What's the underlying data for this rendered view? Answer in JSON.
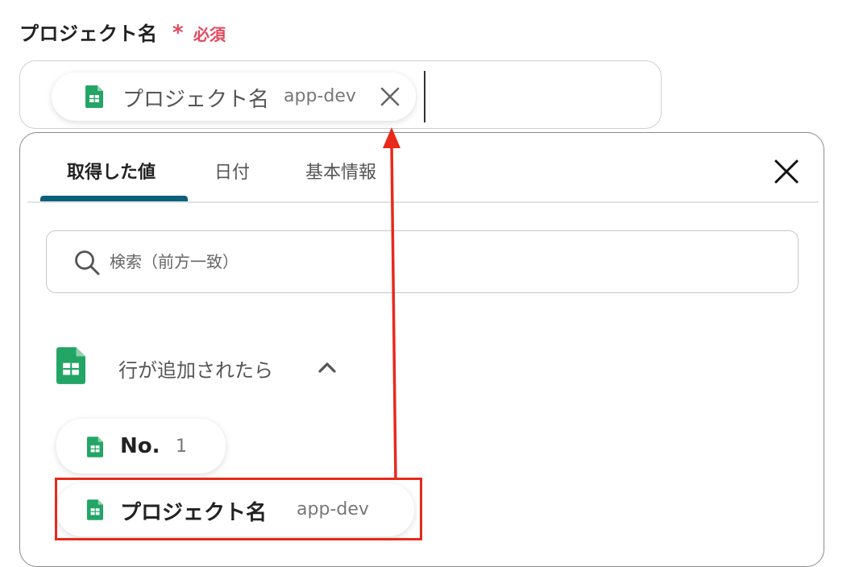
{
  "field": {
    "label": "プロジェクト名",
    "required_mark": "*",
    "required_text": "必須"
  },
  "selected_chip": {
    "icon": "google-sheets-icon",
    "label": "プロジェクト名",
    "value": "app-dev",
    "remove_icon": "close-icon"
  },
  "panel": {
    "tabs": [
      {
        "label": "取得した値",
        "active": true
      },
      {
        "label": "日付",
        "active": false
      },
      {
        "label": "基本情報",
        "active": false
      }
    ],
    "close_icon": "close-icon",
    "search": {
      "placeholder": "検索（前方一致）",
      "value": "",
      "icon": "search-icon"
    },
    "group": {
      "icon": "google-sheets-icon",
      "title": "行が追加されたら",
      "expanded": true,
      "chevron_icon": "chevron-up-icon",
      "items": [
        {
          "label": "No.",
          "value": "1",
          "icon": "google-sheets-icon"
        },
        {
          "label": "プロジェクト名",
          "value": "app-dev",
          "icon": "google-sheets-icon",
          "highlighted": true
        }
      ]
    }
  },
  "colors": {
    "required": "#e5485d",
    "tab_indicator": "#0d6079",
    "annotation": "#e8291c",
    "sheets_green": "#23a566"
  }
}
